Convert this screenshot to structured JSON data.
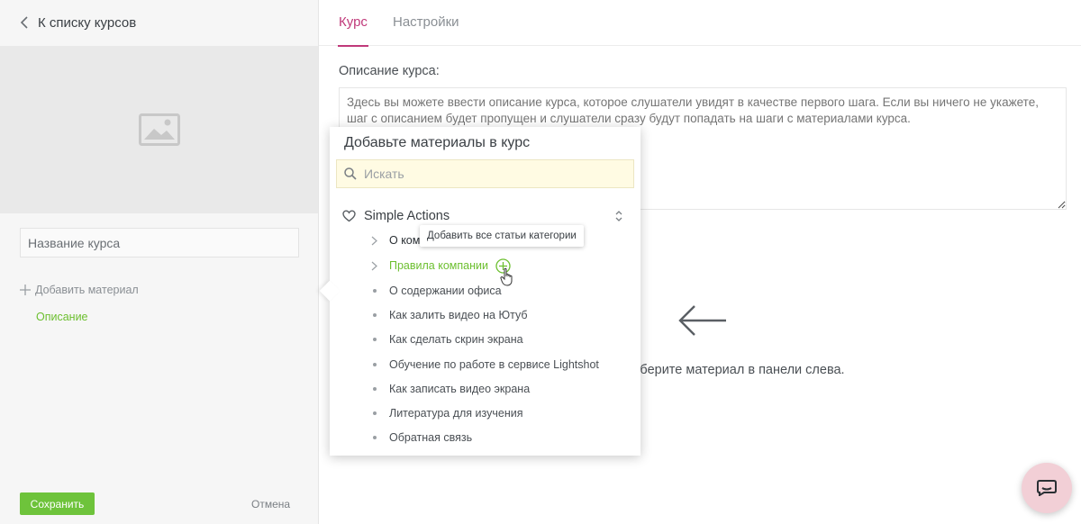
{
  "sidebar": {
    "back_label": "К списку курсов",
    "course_name_placeholder": "Название курса",
    "add_material_label": "Добавить материал",
    "description_link": "Описание",
    "save_label": "Сохранить",
    "cancel_label": "Отмена"
  },
  "tabs": [
    {
      "label": "Курс",
      "active": true
    },
    {
      "label": "Настройки",
      "active": false
    }
  ],
  "main": {
    "description_label": "Описание курса:",
    "description_placeholder": "Здесь вы можете ввести описание курса, которое слушатели увидят в качестве первого шага. Если вы ничего не укажете, шаг с описанием будет пропущен и слушатели сразу будут попадать на шаги с материалами курса.",
    "hint": "ыберите материал в панели слева."
  },
  "popover": {
    "title": "Добавьте материалы в курс",
    "search_placeholder": "Искать",
    "category": "Simple Actions",
    "tooltip": "Добавить все статьи категории",
    "items": [
      {
        "label": "О ком",
        "kind": "folder"
      },
      {
        "label": "Правила компании",
        "kind": "folder-hover"
      },
      {
        "label": "О содержании офиса",
        "kind": "article"
      },
      {
        "label": "Как залить видео на Ютуб",
        "kind": "article"
      },
      {
        "label": "Как сделать скрин экрана",
        "kind": "article"
      },
      {
        "label": "Обучение по работе в сервисе Lightshot",
        "kind": "article"
      },
      {
        "label": "Как записать видео экрана",
        "kind": "article"
      },
      {
        "label": "Литература для изучения",
        "kind": "article"
      },
      {
        "label": "Обратная связь",
        "kind": "article"
      }
    ]
  },
  "colors": {
    "accent": "#c0397a",
    "green": "#6ec33b",
    "chat_bg": "#f2cfd6",
    "search_bg": "#fffbe3"
  },
  "icons": [
    "chevron-left-icon",
    "image-placeholder-icon",
    "plus-icon",
    "search-icon",
    "heart-icon",
    "chevron-updown-icon",
    "chevron-right-icon",
    "plus-circle-icon",
    "hand-cursor-icon",
    "arrow-left-icon",
    "chat-icon"
  ]
}
